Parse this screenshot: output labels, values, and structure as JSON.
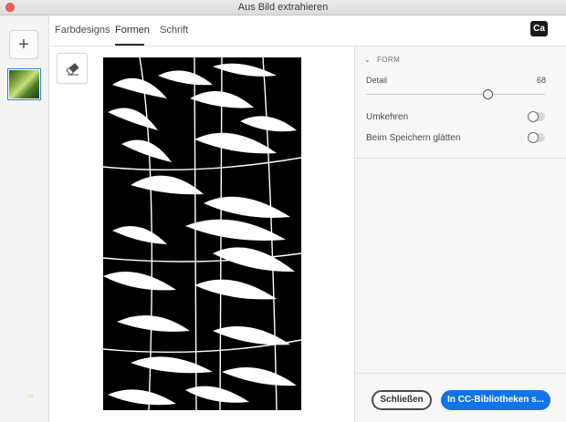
{
  "window": {
    "title": "Aus Bild extrahieren"
  },
  "tabs": [
    {
      "label": "Farbdesigns"
    },
    {
      "label": "Formen"
    },
    {
      "label": "Schrift"
    }
  ],
  "app_badge": "Ca",
  "left_rail": {
    "add_label": "+"
  },
  "panel": {
    "section_title": "FORM",
    "detail_label": "Detail",
    "detail_value": "68",
    "detail_fraction": 0.68,
    "umkehren_label": "Umkehren",
    "umkehren_on": false,
    "smooth_label": "Beim Speichern glätten",
    "smooth_on": false
  },
  "footer": {
    "close_label": "Schließen",
    "save_label": "In CC-Bibliotheken s..."
  },
  "colors": {
    "accent": "#1473e6",
    "close_dot": "#fe5f57"
  }
}
